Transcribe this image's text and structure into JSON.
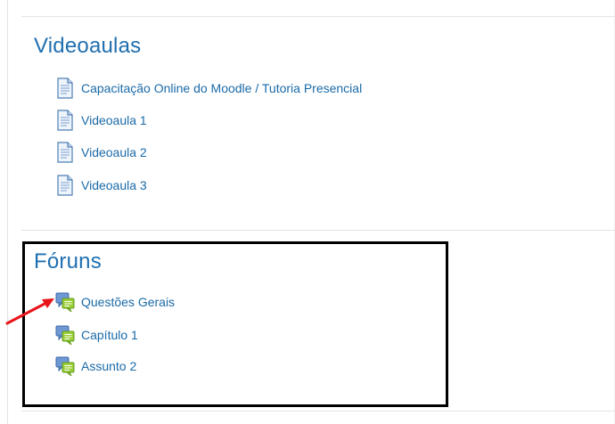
{
  "sections": [
    {
      "title": "Videoaulas",
      "items": [
        {
          "label": "Capacitação Online do Moodle / Tutoria Presencial",
          "icon": "page-icon"
        },
        {
          "label": "Videoaula 1",
          "icon": "page-icon"
        },
        {
          "label": "Videoaula 2",
          "icon": "page-icon"
        },
        {
          "label": "Videoaula 3",
          "icon": "page-icon"
        }
      ]
    },
    {
      "title": "Fóruns",
      "items": [
        {
          "label": "Questões Gerais",
          "icon": "forum-icon"
        },
        {
          "label": "Capítulo 1",
          "icon": "forum-icon"
        },
        {
          "label": "Assunto 2",
          "icon": "forum-icon"
        }
      ]
    }
  ],
  "colors": {
    "link": "#1a6aa8",
    "section_title": "#1f6fb0",
    "annotation_box": "#000000",
    "annotation_arrow": "#e8141a"
  }
}
